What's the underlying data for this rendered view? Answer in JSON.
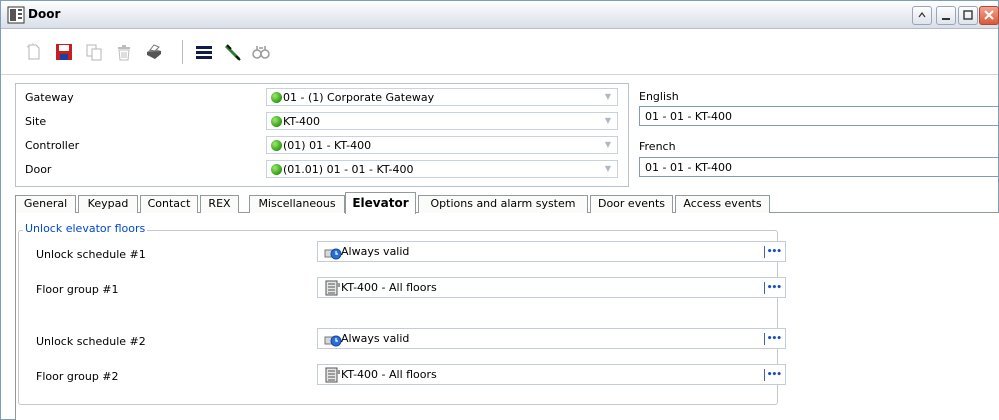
{
  "window": {
    "title": "Door",
    "controls": [
      "restore",
      "minimize",
      "maximize",
      "close"
    ]
  },
  "toolbar": {
    "icons": [
      "new-icon",
      "save-icon",
      "copy-icon",
      "delete-icon",
      "print-icon",
      "list-icon",
      "tools-icon",
      "find-icon"
    ]
  },
  "fields": {
    "gateway": {
      "label": "Gateway",
      "value": "01 - (1)  Corporate Gateway"
    },
    "site": {
      "label": "Site",
      "value": "KT-400"
    },
    "controller": {
      "label": "Controller",
      "value": "(01) 01 - KT-400"
    },
    "door": {
      "label": "Door",
      "value": "(01.01) 01 - 01 - KT-400"
    }
  },
  "languages": {
    "english": {
      "label": "English",
      "value": "01 - 01 - KT-400"
    },
    "french": {
      "label": "French",
      "value": "01 - 01 - KT-400"
    }
  },
  "tabs": [
    {
      "label": "General"
    },
    {
      "label": "Keypad"
    },
    {
      "label": "Contact"
    },
    {
      "label": "REX"
    },
    {
      "label": "Miscellaneous"
    },
    {
      "label": "Elevator",
      "active": true
    },
    {
      "label": "Options and alarm system"
    },
    {
      "label": "Door events"
    },
    {
      "label": "Access events"
    }
  ],
  "elevator": {
    "group_title": "Unlock elevator floors",
    "rows": [
      {
        "label": "Unlock schedule #1",
        "value": "Always valid",
        "icon": "schedule-icon",
        "more": "•••"
      },
      {
        "label": "Floor group #1",
        "value": "KT-400 - All floors",
        "icon": "floor-group-icon",
        "more": "•••"
      },
      {
        "label": "Unlock schedule #2",
        "value": "Always valid",
        "icon": "schedule-icon",
        "more": "•••"
      },
      {
        "label": "Floor group #2",
        "value": "KT-400 - All floors",
        "icon": "floor-group-icon",
        "more": "•••"
      }
    ]
  },
  "colors": {
    "accent_link": "#0046d5",
    "status_ok": "#2f9a14"
  }
}
